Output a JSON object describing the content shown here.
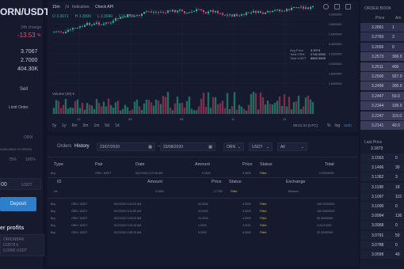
{
  "left_panel": {
    "pair": "ORN/USDT",
    "change_label": "24h change",
    "change_value": "-13.53",
    "change_unit": "%",
    "stats": [
      "3.7067",
      "2.7000",
      "404.30K"
    ],
    "tab_sell": "Sell",
    "limit_order": "Limit Order",
    "asset_orn": "ORN",
    "hint_line": "AVAILABLE IN ORION",
    "pct_75": "75%",
    "pct_100": "100%",
    "amount_value": "00",
    "amount_unit": "USDT",
    "deposit_btn": "Deposit",
    "profits_title": "er profits",
    "profit_lines": [
      "ORIONBRK",
      "0.0578 k",
      "0.0900 USDT"
    ]
  },
  "chart": {
    "toolbar": {
      "timeframe": "15m",
      "indicators": "Indicators",
      "check_api": "Check API"
    },
    "ohlc": [
      "O 3.3071",
      "H 3.3090",
      "L 3.3040",
      "C 3.3060"
    ],
    "price_ticks": [
      "4.0000000",
      "3.8000000",
      "3.6000000",
      "3.4000000",
      "3.2000000",
      "3.0000000",
      "2.8000000",
      "2.6000000"
    ],
    "avg_labels": [
      "Avg Price",
      "Total ORN",
      "Total USDT"
    ],
    "avg_values": [
      "3.2074",
      "2742.0000",
      "8863.3605"
    ],
    "volume_label": "Volume (20) ▾",
    "volume_value": "",
    "time_ticks": [
      "12",
      "05",
      "08",
      "11",
      "14"
    ],
    "range_buttons": [
      "5y",
      "1y",
      "6m",
      "3m",
      "1m",
      "5d",
      "1d"
    ],
    "clock": "08:21:31 (UTC)",
    "scale_opts": [
      "%",
      "log",
      "auto"
    ]
  },
  "orders": {
    "tabs": [
      "Orders",
      "History"
    ],
    "date_from": "23/07/2020",
    "date_to": "23/08/2020",
    "asset": "ORN",
    "quote": "USDT",
    "status": "All",
    "headers": [
      "Type",
      "Pair",
      "Date",
      "Amount",
      "Price",
      "Status",
      "Total"
    ],
    "sub_headers": [
      "ID",
      "Amount",
      "Price",
      "Status",
      "Exchange"
    ],
    "first_row": [
      "Buy",
      "ORN / USDT",
      "8/22/2020 2:07:06 AM",
      "5.0000",
      "3.3500",
      "Filled",
      "0.00000000"
    ],
    "sub_row": [
      "ins",
      "0.0000",
      "3.7783",
      "Filled",
      "Binance"
    ],
    "rows": [
      [
        "Buy",
        "ORN / USDT",
        "8/22/2020 3:14:09 AM",
        "40.0000",
        "4.0000",
        "Filled",
        "160.00000000"
      ],
      [
        "Buy",
        "ORN / USDT",
        "8/22/2020 3:11:55 AM",
        "40.0000",
        "4.0000",
        "Filled",
        "160.00000000"
      ],
      [
        "Buy",
        "ORN / USDT",
        "8/22/2020 3:09:02 AM",
        "20.0000",
        "4.0000",
        "Filled",
        "80.00000000"
      ],
      [
        "Buy",
        "ORN / USDT",
        "8/22/2020 3:02:45 AM",
        "1.0000",
        "4.0121",
        "Filled",
        "4.01210000"
      ],
      [
        "Buy",
        "ORN / USDT",
        "8/22/2020 2:55:29 AM",
        "5.0000",
        "4.0000",
        "Filled",
        "20.00000000"
      ]
    ]
  },
  "order_book": {
    "title": "ORDER BOOK",
    "col_price": "Price",
    "col_amount": "Am",
    "asks": [
      [
        "3.2891",
        "1"
      ],
      [
        "3.2783",
        "3"
      ],
      [
        "3.2656",
        "0"
      ],
      [
        "3.2573",
        "306.0"
      ],
      [
        "3.2511",
        "400"
      ],
      [
        "3.2500",
        "927.0"
      ],
      [
        "3.2499",
        "300.0"
      ],
      [
        "3.2447",
        "50.0"
      ],
      [
        "3.2344",
        "109.0"
      ],
      [
        "3.2247",
        "115.0"
      ],
      [
        "3.2141",
        "40.0"
      ]
    ],
    "last_label": "Last Price",
    "last_price": "3.1873",
    "bids": [
      [
        "3.1563",
        "0"
      ],
      [
        "3.1496",
        "30"
      ],
      [
        "3.1362",
        "3"
      ],
      [
        "3.1198",
        "18"
      ],
      [
        "3.1097",
        "115"
      ],
      [
        "3.1000",
        "0"
      ],
      [
        "3.0994",
        "136"
      ],
      [
        "3.0968",
        "0"
      ],
      [
        "3.0791",
        "50"
      ],
      [
        "3.0788",
        "0"
      ],
      [
        "3.0599",
        "40"
      ]
    ]
  },
  "colors": {
    "up": "#1fbf93",
    "down": "#e0477a",
    "accent": "#2d7ecb",
    "filled": "#c8b94a"
  }
}
